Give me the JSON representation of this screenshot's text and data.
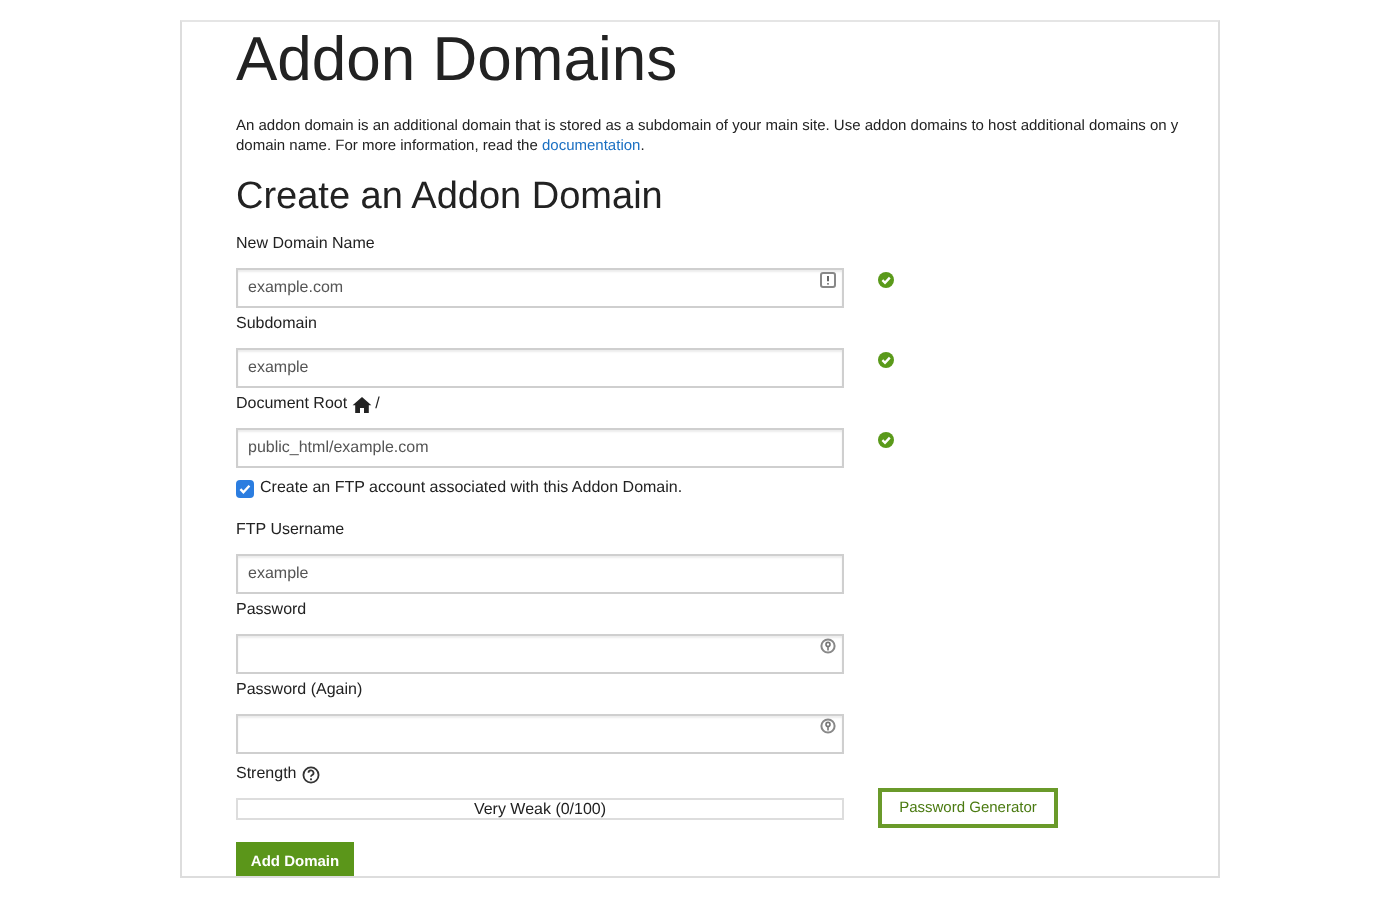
{
  "title": "Addon Domains",
  "intro": {
    "line_1": "An addon domain is an additional domain that is stored as a subdomain of your main site. Use addon domains to host additional domains on y",
    "line_2": "domain name. For more information, read the",
    "link": "documentation",
    "end": "."
  },
  "form_title": "Create an Addon Domain",
  "fields_top": [
    {
      "label": "New Domain Name",
      "value": "example.com",
      "kind": "info",
      "valid": true
    },
    {
      "label": "Subdomain",
      "value": "example",
      "kind": "plain",
      "valid": true
    },
    {
      "label": "Document Root",
      "home_icon": true,
      "label_suffix": "/",
      "value": "public_html/example.com",
      "kind": "plain",
      "valid": true
    }
  ],
  "ftp_checkbox": {
    "label": "Create an FTP account associated with this Addon Domain.",
    "checked": true
  },
  "fields_ftp": [
    {
      "label": "FTP Username",
      "value": "example",
      "kind": "plain",
      "valid": false
    },
    {
      "label": "Password",
      "kind": "password",
      "valid": false
    },
    {
      "label": "Password (Again)",
      "kind": "password",
      "valid": false
    }
  ],
  "strength": {
    "label": "Strength",
    "level": 0,
    "reading": "Very Weak (0/100)"
  },
  "generator_button": "Password Generator",
  "submit_button": "Add Domain"
}
